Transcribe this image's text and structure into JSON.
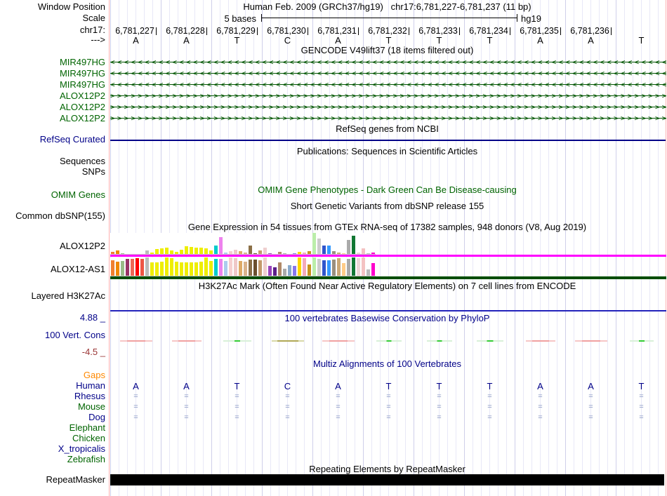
{
  "header": {
    "window_position_label": "Window Position",
    "assembly_text": "Human Feb. 2009 (GRCh37/hg19)",
    "position_text": "chr17:6,781,227-6,781,237 (11 bp)",
    "scale_label": "Scale",
    "scale_text": "5 bases",
    "scale_genome": "hg19",
    "chrom_label": "chr17:",
    "direction_label": "--->",
    "coordinates": [
      "6,781,227",
      "6,781,228",
      "6,781,229",
      "6,781,230",
      "6,781,231",
      "6,781,232",
      "6,781,233",
      "6,781,234",
      "6,781,235",
      "6,781,236"
    ],
    "sequence": [
      "A",
      "A",
      "T",
      "C",
      "A",
      "T",
      "T",
      "T",
      "A",
      "A",
      "T"
    ]
  },
  "gencode": {
    "title": "GENCODE V49lift37 (18 items filtered out)",
    "genes": [
      {
        "name": "MIR497HG",
        "strand": "left"
      },
      {
        "name": "MIR497HG",
        "strand": "left"
      },
      {
        "name": "MIR497HG",
        "strand": "left"
      },
      {
        "name": "ALOX12P2",
        "strand": "right"
      },
      {
        "name": "ALOX12P2",
        "strand": "right"
      },
      {
        "name": "ALOX12P2",
        "strand": "right"
      }
    ]
  },
  "refseq": {
    "title": "RefSeq genes from NCBI",
    "label": "RefSeq Curated"
  },
  "publications": {
    "title": "Publications: Sequences in Scientific Articles",
    "sequences_label": "Sequences",
    "snps_label": "SNPs"
  },
  "omim": {
    "title": "OMIM Gene Phenotypes - Dark Green Can Be Disease-causing",
    "label": "OMIM Genes"
  },
  "dbsnp": {
    "title": "Short Genetic Variants from dbSNP release 155",
    "label": "Common dbSNP(155)"
  },
  "gtex": {
    "title": "Gene Expression in 54 tissues from GTEx RNA-seq of 17382 samples, 948 donors (V8, Aug 2019)",
    "track1_label": "ALOX12P2",
    "track2_label": "ALOX12-AS1",
    "bars": [
      {
        "color": "#F08030",
        "p2": 3,
        "as1": 22
      },
      {
        "color": "#EE8800",
        "p2": 5,
        "as1": 20
      },
      {
        "color": "#99BB88",
        "p2": 1,
        "as1": 21
      },
      {
        "color": "#993366",
        "p2": 0,
        "as1": 24
      },
      {
        "color": "#EE6655",
        "p2": 0,
        "as1": 24
      },
      {
        "color": "#FF0000",
        "p2": 0,
        "as1": 25
      },
      {
        "color": "#EE5544",
        "p2": 0,
        "as1": 24
      },
      {
        "color": "#BBBBBB",
        "p2": 5,
        "as1": 26
      },
      {
        "color": "#EEEE00",
        "p2": 2,
        "as1": 19
      },
      {
        "color": "#EEEE00",
        "p2": 7,
        "as1": 19
      },
      {
        "color": "#EEEE00",
        "p2": 8,
        "as1": 20
      },
      {
        "color": "#EEEE00",
        "p2": 9,
        "as1": 26
      },
      {
        "color": "#EEEE00",
        "p2": 5,
        "as1": 25
      },
      {
        "color": "#EEEE00",
        "p2": 3,
        "as1": 20
      },
      {
        "color": "#EEEE00",
        "p2": 6,
        "as1": 19
      },
      {
        "color": "#EEEE00",
        "p2": 11,
        "as1": 19
      },
      {
        "color": "#EEEE00",
        "p2": 10,
        "as1": 19
      },
      {
        "color": "#EEEE00",
        "p2": 9,
        "as1": 19
      },
      {
        "color": "#EEEE00",
        "p2": 9,
        "as1": 20
      },
      {
        "color": "#EEEE00",
        "p2": 8,
        "as1": 26
      },
      {
        "color": "#EEEE00",
        "p2": 5,
        "as1": 21
      },
      {
        "color": "#00CCCC",
        "p2": 12,
        "as1": 24
      },
      {
        "color": "#EE82EE",
        "p2": 24,
        "as1": 24
      },
      {
        "color": "#AACCEE",
        "p2": 2,
        "as1": 21
      },
      {
        "color": "#F6CFCF",
        "p2": 4,
        "as1": 26
      },
      {
        "color": "#EFC8C8",
        "p2": 6,
        "as1": 25
      },
      {
        "color": "#DDAA66",
        "p2": 4,
        "as1": 21
      },
      {
        "color": "#D9B38C",
        "p2": 2,
        "as1": 20
      },
      {
        "color": "#8B6F47",
        "p2": 12,
        "as1": 23
      },
      {
        "color": "#6B4F2F",
        "p2": 1,
        "as1": 23
      },
      {
        "color": "#C49A6C",
        "p2": 5,
        "as1": 22
      },
      {
        "color": "#EFCFCF",
        "p2": 9,
        "as1": 26
      },
      {
        "color": "#9944BB",
        "p2": 1,
        "as1": 14
      },
      {
        "color": "#5C1E8A",
        "p2": 0,
        "as1": 12
      },
      {
        "color": "#B08968",
        "p2": 3,
        "as1": 19
      },
      {
        "color": "#AAAAAA",
        "p2": 1,
        "as1": 10
      },
      {
        "color": "#88AACC",
        "p2": 0,
        "as1": 15
      },
      {
        "color": "#8877EE",
        "p2": 1,
        "as1": 14
      },
      {
        "color": "#FFD700",
        "p2": 3,
        "as1": 26
      },
      {
        "color": "#F4AABB",
        "p2": 2,
        "as1": 25
      },
      {
        "color": "#C8921E",
        "p2": 4,
        "as1": 16
      },
      {
        "color": "#BBEEAA",
        "p2": 30,
        "as1": 26
      },
      {
        "color": "#CCCCCC",
        "p2": 22,
        "as1": 24
      },
      {
        "color": "#2F55CC",
        "p2": 12,
        "as1": 22
      },
      {
        "color": "#3399FF",
        "p2": 12,
        "as1": 22
      },
      {
        "color": "#9A8F7F",
        "p2": 4,
        "as1": 23
      },
      {
        "color": "#CBA877",
        "p2": 2,
        "as1": 25
      },
      {
        "color": "#FFCC88",
        "p2": 1,
        "as1": 18
      },
      {
        "color": "#AAAAAA",
        "p2": 20,
        "as1": 24
      },
      {
        "color": "#117733",
        "p2": 26,
        "as1": 26
      },
      {
        "color": "#EBD6D6",
        "p2": 2,
        "as1": 25
      },
      {
        "color": "#F4C2C2",
        "p2": 8,
        "as1": 26
      },
      {
        "color": "#BBBBBB",
        "p2": 1,
        "as1": 9
      },
      {
        "color": "#FF00CC",
        "p2": 2,
        "as1": 18
      }
    ]
  },
  "encode": {
    "title": "H3K27Ac Mark (Often Found Near Active Regulatory Elements) on 7 cell lines from ENCODE",
    "label": "Layered H3K27Ac"
  },
  "phylop": {
    "title": "100 vertebrates Basewise Conservation by PhyloP",
    "label": "100 Vert. Cons",
    "max_label": "4.88 _",
    "min_label": "-4.5 _",
    "segments": [
      {
        "bg": "#F6C6C6",
        "bgw": 46,
        "fg": "#F0A0A0",
        "fgw": 26
      },
      {
        "bg": "#F6C6C6",
        "bgw": 42,
        "fg": "#F0A0A0",
        "fgw": 24
      },
      {
        "bg": "#D8F0D8",
        "bgw": 40,
        "fg": "#33CC33",
        "fgw": 8
      },
      {
        "bg": "#D8D8A8",
        "bgw": 46,
        "fg": "#B0A855",
        "fgw": 30
      },
      {
        "bg": "#F6C6C6",
        "bgw": 46,
        "fg": "#F0A0A0",
        "fgw": 26
      },
      {
        "bg": "#D8F0D8",
        "bgw": 36,
        "fg": "#33CC33",
        "fgw": 7
      },
      {
        "bg": "#D8F0D8",
        "bgw": 36,
        "fg": "#33CC33",
        "fgw": 7
      },
      {
        "bg": "#D8F0D8",
        "bgw": 38,
        "fg": "#33CC33",
        "fgw": 9
      },
      {
        "bg": "#F6C6C6",
        "bgw": 42,
        "fg": "#F0A0A0",
        "fgw": 24
      },
      {
        "bg": "#F6C6C6",
        "bgw": 46,
        "fg": "#F0A0A0",
        "fgw": 26
      },
      {
        "bg": "#D8F0D8",
        "bgw": 34,
        "fg": "#33CC33",
        "fgw": 8
      }
    ]
  },
  "multiz": {
    "title": "Multiz Alignments of 100 Vertebrates",
    "gaps_label": "Gaps",
    "match_mark": "=",
    "rows": [
      {
        "label": "Gaps",
        "color": "orange",
        "content": "empty"
      },
      {
        "label": "Human",
        "color": "navy",
        "content": "bases"
      },
      {
        "label": "Rhesus",
        "color": "navy",
        "content": "match"
      },
      {
        "label": "Mouse",
        "color": "green",
        "content": "match"
      },
      {
        "label": "Dog",
        "color": "navy",
        "content": "match"
      },
      {
        "label": "Elephant",
        "color": "green",
        "content": "empty"
      },
      {
        "label": "Chicken",
        "color": "green",
        "content": "empty"
      },
      {
        "label": "X_tropicalis",
        "color": "navy",
        "content": "empty"
      },
      {
        "label": "Zebrafish",
        "color": "green",
        "content": "empty"
      }
    ]
  },
  "repeatmasker": {
    "title": "Repeating Elements by RepeatMasker",
    "label": "RepeatMasker"
  },
  "colors": {
    "track_line_green": "#005500",
    "refseq_line": "#000088",
    "gtex_p2_line": "#FF00FF",
    "gtex_as1_line": "#004D00",
    "h3k27ac_line": "#2222BB",
    "grid_light": "#E8E8F7",
    "grid_boundary": "#CFCFEA",
    "edge_pink": "#FFB0B0",
    "repeat_bar": "#000000",
    "label_navy": "#000088",
    "label_green": "#006400",
    "label_orange": "#FF8800",
    "min_label_maroon": "#993333"
  }
}
